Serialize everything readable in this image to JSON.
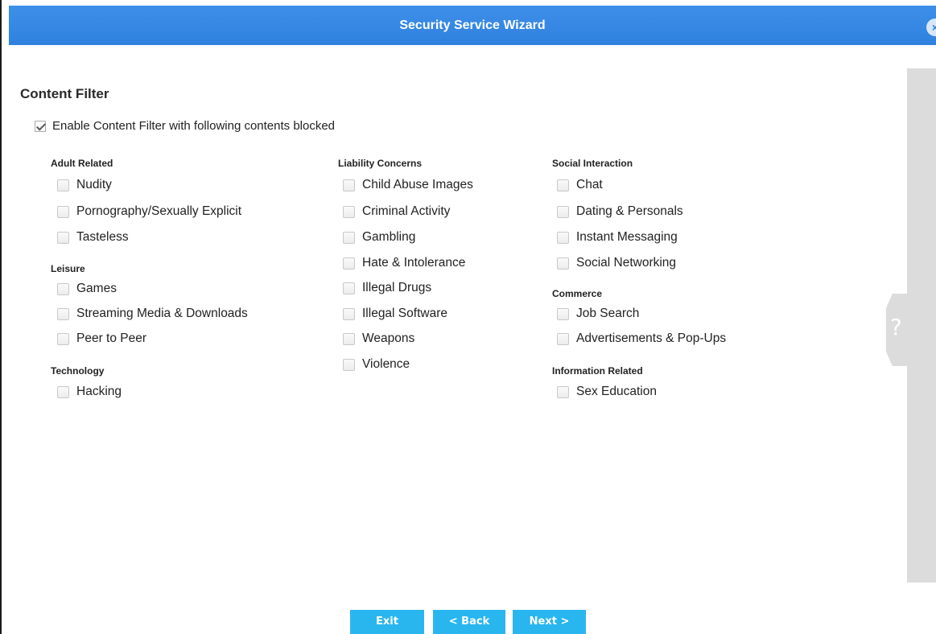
{
  "window": {
    "title": "Security Service Wizard"
  },
  "content_filter": {
    "title": "Content Filter",
    "enable_label": "Enable Content Filter with following contents blocked",
    "enabled": true
  },
  "groups": {
    "adult": {
      "title": "Adult Related",
      "items": [
        "Nudity",
        "Pornography/Sexually Explicit",
        "Tasteless"
      ]
    },
    "leisure": {
      "title": "Leisure",
      "items": [
        "Games",
        "Streaming Media & Downloads",
        "Peer to Peer"
      ]
    },
    "technology": {
      "title": "Technology",
      "items": [
        "Hacking"
      ]
    },
    "liability": {
      "title": "Liability Concerns",
      "items": [
        "Child Abuse Images",
        "Criminal Activity",
        "Gambling",
        "Hate & Intolerance",
        "Illegal Drugs",
        "Illegal Software",
        "Weapons",
        "Violence"
      ]
    },
    "social": {
      "title": "Social Interaction",
      "items": [
        "Chat",
        "Dating & Personals",
        "Instant Messaging",
        "Social Networking"
      ]
    },
    "commerce": {
      "title": "Commerce",
      "items": [
        "Job Search",
        "Advertisements & Pop-Ups"
      ]
    },
    "information": {
      "title": "Information Related",
      "items": [
        "Sex Education"
      ]
    }
  },
  "buttons": {
    "exit": "Exit",
    "back": "< Back",
    "next": "Next >"
  },
  "help": {
    "glyph": "?"
  },
  "colors": {
    "titlebar": "#2f81df",
    "button": "#29b6ef",
    "panel": "#dcdcdc"
  }
}
